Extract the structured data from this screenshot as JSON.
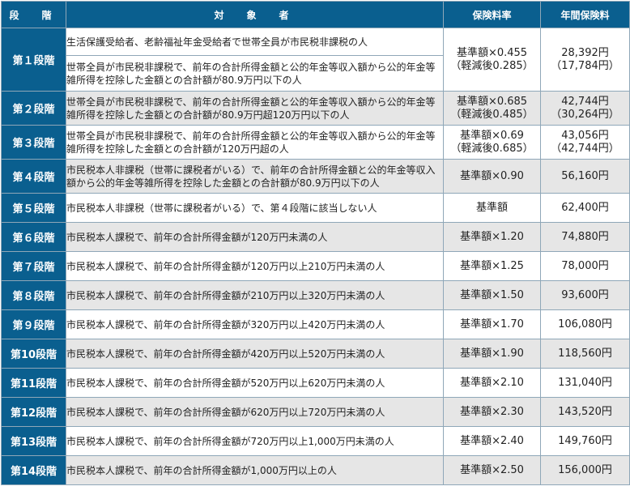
{
  "headers": {
    "stage": "段　階",
    "target": "対　象　者",
    "rate": "保険料率",
    "annual": "年間保険料"
  },
  "rows": [
    {
      "stage": "第１段階",
      "targets": [
        "生活保護受給者、老齢福祉年金受給者で世帯全員が市民税非課税の人",
        "世帯全員が市民税非課税で、前年の合計所得金額と公的年金等収入額から公的年金等雑所得を控除した金額との合計額が80.9万円以下の人"
      ],
      "rate": "基準額×0.455",
      "rate_sub": "（軽減後0.285）",
      "annual": "28,392円",
      "annual_sub": "（17,784円）"
    },
    {
      "stage": "第２段階",
      "target": "世帯全員が市民税非課税で、前年の合計所得金額と公的年金等収入額から公的年金等雑所得を控除した金額との合計額が80.9万円超120万円以下の人",
      "rate": "基準額×0.685",
      "rate_sub": "（軽減後0.485）",
      "annual": "42,744円",
      "annual_sub": "（30,264円）"
    },
    {
      "stage": "第３段階",
      "target": "世帯全員が市民税非課税で、前年の合計所得金額と公的年金等収入額から公的年金等雑所得を控除した金額との合計額が120万円超の人",
      "rate": "基準額×0.69",
      "rate_sub": "（軽減後0.685）",
      "annual": "43,056円",
      "annual_sub": "（42,744円）"
    },
    {
      "stage": "第４段階",
      "target": "市民税本人非課税（世帯に課税者がいる）で、前年の合計所得金額と公的年金等収入額から公的年金等雑所得を控除した金額との合計額が80.9万円以下の人",
      "rate": "基準額×0.90",
      "annual": "56,160円"
    },
    {
      "stage": "第５段階",
      "target": "市民税本人非課税（世帯に課税者がいる）で、第４段階に該当しない人",
      "rate": "基準額",
      "annual": "62,400円"
    },
    {
      "stage": "第６段階",
      "target": "市民税本人課税で、前年の合計所得金額が120万円未満の人",
      "rate": "基準額×1.20",
      "annual": "74,880円"
    },
    {
      "stage": "第７段階",
      "target": "市民税本人課税で、前年の合計所得金額が120万円以上210万円未満の人",
      "rate": "基準額×1.25",
      "annual": "78,000円"
    },
    {
      "stage": "第８段階",
      "target": "市民税本人課税で、前年の合計所得金額が210万円以上320万円未満の人",
      "rate": "基準額×1.50",
      "annual": "93,600円"
    },
    {
      "stage": "第９段階",
      "target": "市民税本人課税で、前年の合計所得金額が320万円以上420万円未満の人",
      "rate": "基準額×1.70",
      "annual": "106,080円"
    },
    {
      "stage": "第10段階",
      "target": "市民税本人課税で、前年の合計所得金額が420万円以上520万円未満の人",
      "rate": "基準額×1.90",
      "annual": "118,560円"
    },
    {
      "stage": "第11段階",
      "target": "市民税本人課税で、前年の合計所得金額が520万円以上620万円未満の人",
      "rate": "基準額×2.10",
      "annual": "131,040円"
    },
    {
      "stage": "第12段階",
      "target": "市民税本人課税で、前年の合計所得金額が620万円以上720万円未満の人",
      "rate": "基準額×2.30",
      "annual": "143,520円"
    },
    {
      "stage": "第13段階",
      "target": "市民税本人課税で、前年の合計所得金額が720万円以上1,000万円未満の人",
      "rate": "基準額×2.40",
      "annual": "149,760円"
    },
    {
      "stage": "第14段階",
      "target": "市民税本人課税で、前年の合計所得金額が1,000万円以上の人",
      "rate": "基準額×2.50",
      "annual": "156,000円"
    }
  ]
}
